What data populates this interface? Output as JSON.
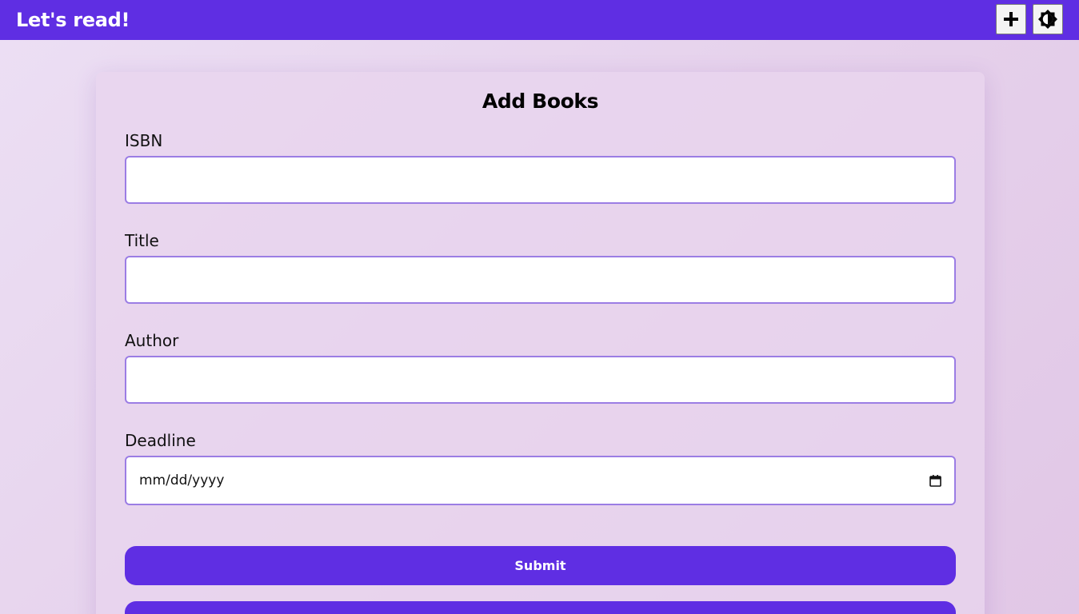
{
  "header": {
    "title": "Let's read!",
    "add_icon": "plus-icon",
    "theme_icon": "brightness-icon",
    "accent_color": "#5f2ee3"
  },
  "form": {
    "title": "Add Books",
    "fields": [
      {
        "label": "ISBN",
        "value": ""
      },
      {
        "label": "Title",
        "value": ""
      },
      {
        "label": "Author",
        "value": ""
      },
      {
        "label": "Deadline",
        "value": "",
        "placeholder": "mm/dd/yyyy",
        "icon": "calendar-icon"
      }
    ],
    "submit_label": "Submit",
    "secondary_label": ""
  }
}
